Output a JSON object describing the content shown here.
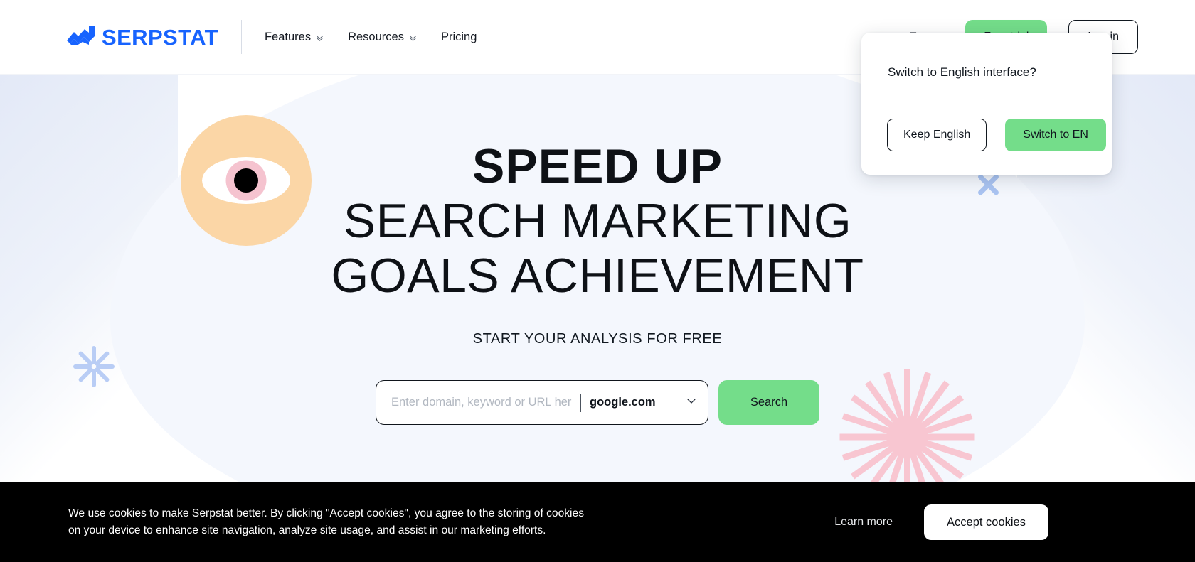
{
  "brand": {
    "name": "SERPSTAT",
    "logo_color": "#1763fe",
    "accent_green": "#74dd8a"
  },
  "header": {
    "nav": [
      {
        "label": "Features",
        "has_dropdown": true
      },
      {
        "label": "Resources",
        "has_dropdown": true
      },
      {
        "label": "Pricing",
        "has_dropdown": false
      }
    ],
    "language": {
      "label": "En",
      "has_dropdown": true
    },
    "trial_button": "Free trial",
    "login_button": "Log in"
  },
  "hero": {
    "headline_line1": "SPEED UP",
    "headline_line2": "SEARCH MARKETING",
    "headline_line3": "GOALS ACHIEVEMENT",
    "subtitle": "START YOUR ANALYSIS FOR FREE",
    "search": {
      "placeholder": "Enter domain, keyword or URL here",
      "value": "",
      "engine": "google.com",
      "button": "Search"
    }
  },
  "language_popup": {
    "title": "Switch to English interface?",
    "keep_button": "Keep English",
    "switch_button": "Switch to EN"
  },
  "cookie_banner": {
    "line1": "We use cookies to make Serpstat better. By clicking \"Accept cookies\", you agree to the storing of cookies",
    "line2": "on your device to enhance site navigation, analyze site usage, and assist in our marketing efforts.",
    "learn_more": "Learn more",
    "accept_button": "Accept cookies"
  }
}
